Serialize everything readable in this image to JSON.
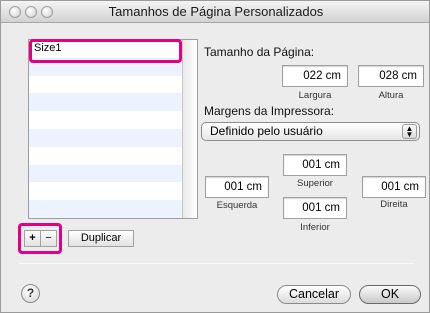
{
  "window": {
    "title": "Tamanhos de Página Personalizados"
  },
  "size_list": {
    "items": [
      "Size1"
    ],
    "selected": "Size1"
  },
  "page_size": {
    "heading": "Tamanho da Página:",
    "width_value": "022 cm",
    "width_label": "Largura",
    "height_value": "028 cm",
    "height_label": "Altura"
  },
  "margins": {
    "heading": "Margens da Impressora:",
    "mode_selected": "Definido pelo usuário",
    "top_value": "001 cm",
    "top_label": "Superior",
    "left_value": "001 cm",
    "left_label": "Esquerda",
    "right_value": "001 cm",
    "right_label": "Direita",
    "bottom_value": "001 cm",
    "bottom_label": "Inferior"
  },
  "list_controls": {
    "add_label": "+",
    "remove_label": "−",
    "duplicate_label": "Duplicar"
  },
  "footer": {
    "help_label": "?",
    "cancel_label": "Cancelar",
    "ok_label": "OK"
  },
  "colors": {
    "highlight": "#e4007f",
    "window_bg": "#ececec",
    "list_stripe": "#edf3fe"
  }
}
